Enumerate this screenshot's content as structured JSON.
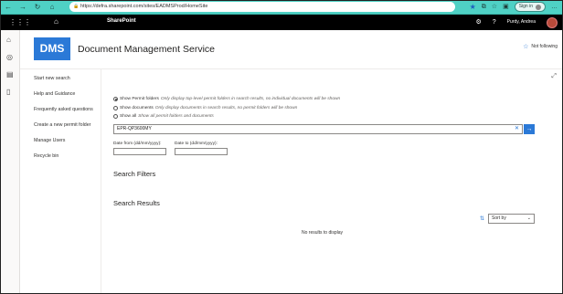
{
  "browser": {
    "url": "https://defra.sharepoint.com/sites/EADMSProd/HomeSite",
    "signin_label": "Sign in",
    "back_icon": "arrow-left-icon",
    "forward_icon": "arrow-right-icon",
    "refresh_icon": "refresh-icon",
    "home_icon": "home-icon"
  },
  "suite": {
    "app_name": "SharePoint",
    "user_name": "Purdy, Andrea"
  },
  "site": {
    "logo_text": "DMS",
    "title": "Document Management Service",
    "follow_label": "Not following",
    "accent_color": "#2b79d7"
  },
  "left_nav": {
    "items": [
      {
        "label": "Start new search"
      },
      {
        "label": "Help and Guidance"
      },
      {
        "label": "Frequently asked questions"
      },
      {
        "label": "Create a new permit folder"
      },
      {
        "label": "Manage Users"
      },
      {
        "label": "Recycle bin"
      }
    ]
  },
  "search": {
    "options": [
      {
        "label": "Show Permit folders",
        "hint": "Only display top-level permit folders in search results, no individual documents will be shown",
        "checked": true
      },
      {
        "label": "Show documents",
        "hint": "Only display documents in search results, no permit folders will be shown",
        "checked": false
      },
      {
        "label": "Show all",
        "hint": "Show all permit folders and documents",
        "checked": false
      }
    ],
    "query": "EPR-QP3600MY",
    "date_from_label": "Date from (dd/mm/yyyy):",
    "date_to_label": "Date to (dd/mm/yyyy):",
    "date_from_value": "",
    "date_to_value": ""
  },
  "filters": {
    "title": "Search Filters"
  },
  "results": {
    "title": "Search Results",
    "sort_label": "Sort by",
    "empty_message": "No results to display"
  }
}
